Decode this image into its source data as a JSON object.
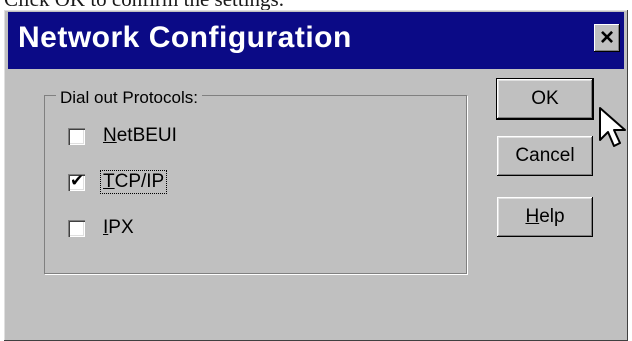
{
  "page_caption": "Click OK to confirm the settings.",
  "dialog": {
    "title": "Network Configuration",
    "close_glyph": "×"
  },
  "group": {
    "label": "Dial out Protocols:",
    "protocols": [
      {
        "accel": "N",
        "rest": "etBEUI",
        "checked": false
      },
      {
        "accel": "T",
        "rest": "CP/IP",
        "checked": true
      },
      {
        "accel": "I",
        "rest": "PX",
        "checked": false
      }
    ]
  },
  "buttons": {
    "ok": "OK",
    "cancel": "Cancel",
    "help_accel": "H",
    "help_rest": "elp"
  },
  "colors": {
    "title_bar": "#0b0a86",
    "dialog_face": "#c0c0c0"
  },
  "icons": {
    "cursor": "mouse-pointer-icon",
    "check": "checkmark"
  }
}
